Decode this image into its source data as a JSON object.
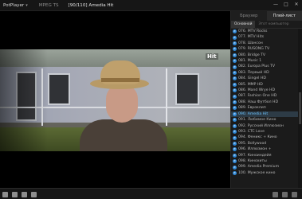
{
  "titlebar": {
    "app_name": "PotPlayer",
    "menu_caret": "▾",
    "tab_label": "MPEG TS",
    "title": "[90/110] Amedia Hit",
    "controls": {
      "min": "—",
      "max": "□",
      "close": "✕"
    }
  },
  "video": {
    "logo_text": "Hit"
  },
  "panel": {
    "tabs": [
      {
        "label": "Браузер",
        "active": false
      },
      {
        "label": "Плей-лист",
        "active": true
      }
    ],
    "subtabs": [
      {
        "label": "Основной",
        "active": true
      },
      {
        "label": "Этот компьютер",
        "active": false
      }
    ],
    "items": [
      {
        "label": "076. MTV Rocks",
        "selected": false
      },
      {
        "label": "077. MTV Hits",
        "selected": false
      },
      {
        "label": "078. Шансон",
        "selected": false
      },
      {
        "label": "079. RUSONG TV",
        "selected": false
      },
      {
        "label": "080. Bridge TV",
        "selected": false
      },
      {
        "label": "081. Music 1",
        "selected": false
      },
      {
        "label": "082. Europa Plus TV",
        "selected": false
      },
      {
        "label": "083. Первый HD",
        "selected": false
      },
      {
        "label": "084. Gingel HD",
        "selected": false
      },
      {
        "label": "085. MMP HD",
        "selected": false
      },
      {
        "label": "086. Mand Wrye HD",
        "selected": false
      },
      {
        "label": "087. Fashion One HD",
        "selected": false
      },
      {
        "label": "088. Наш Футбол HD",
        "selected": false
      },
      {
        "label": "089. Евроклип",
        "selected": false
      },
      {
        "label": "090. Amedia Hit",
        "selected": true
      },
      {
        "label": "091. Любимое Кино",
        "selected": false
      },
      {
        "label": "092. Русский Иллюзион",
        "selected": false
      },
      {
        "label": "093. CTC Love",
        "selected": false
      },
      {
        "label": "094. Феникс + Кино",
        "selected": false
      },
      {
        "label": "095. Bollywood",
        "selected": false
      },
      {
        "label": "096. Иллюзион +",
        "selected": false
      },
      {
        "label": "097. Киноиндейя",
        "selected": false
      },
      {
        "label": "098. Кинохиты",
        "selected": false
      },
      {
        "label": "099. Amedia Premium",
        "selected": false
      },
      {
        "label": "100. Мужское кино",
        "selected": false
      }
    ]
  },
  "colors": {
    "selected_text": "#6cc4ff",
    "selected_bg": "#2d3b46",
    "icon": "#2f89d8"
  }
}
